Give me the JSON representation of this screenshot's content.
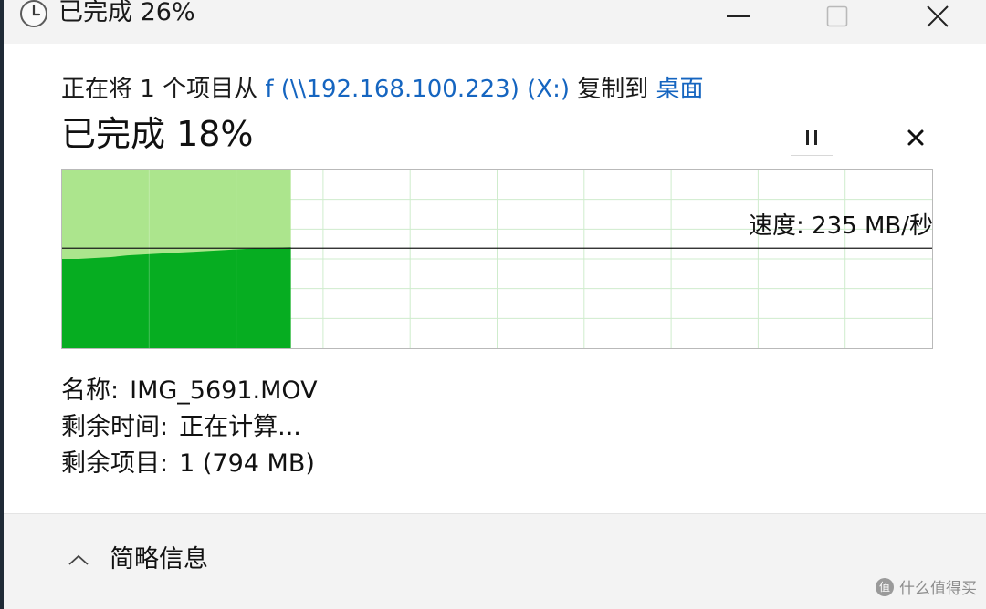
{
  "window": {
    "title": "已完成 26%",
    "title_icon": "clock-icon",
    "minimize_icon": "minimize-icon",
    "maximize_icon": "maximize-icon",
    "close_icon": "close-icon"
  },
  "copy": {
    "prefix": "正在将 1 个项目从",
    "source": "f (\\\\192.168.100.223) (X:)",
    "middle": "复制到",
    "destination": "桌面",
    "progress_text": "已完成 18%",
    "progress_percent": 18,
    "pause_icon": "pause-icon",
    "cancel_icon": "cancel-icon"
  },
  "graph": {
    "speed_text": "速度: 235 MB/秒",
    "progress_fraction": 0.263,
    "speed_line_fraction": 0.56,
    "fill_color": "#06ad21",
    "background_fill_color": "#ace58d",
    "grid_color": "#cfeccd",
    "speed_profile": [
      0.5,
      0.5,
      0.505,
      0.51,
      0.52,
      0.525,
      0.53,
      0.535,
      0.54,
      0.545,
      0.55,
      0.555,
      0.56,
      0.562,
      0.565
    ]
  },
  "details": {
    "name_label": "名称:",
    "name_value": "IMG_5691.MOV",
    "time_label": "剩余时间:",
    "time_value": "正在计算...",
    "items_label": "剩余项目:",
    "items_value": "1 (794 MB)"
  },
  "footer": {
    "toggle_icon": "chevron-up-icon",
    "toggle_label": "简略信息"
  },
  "watermark": {
    "icon_text": "值",
    "text": "什么值得买"
  }
}
